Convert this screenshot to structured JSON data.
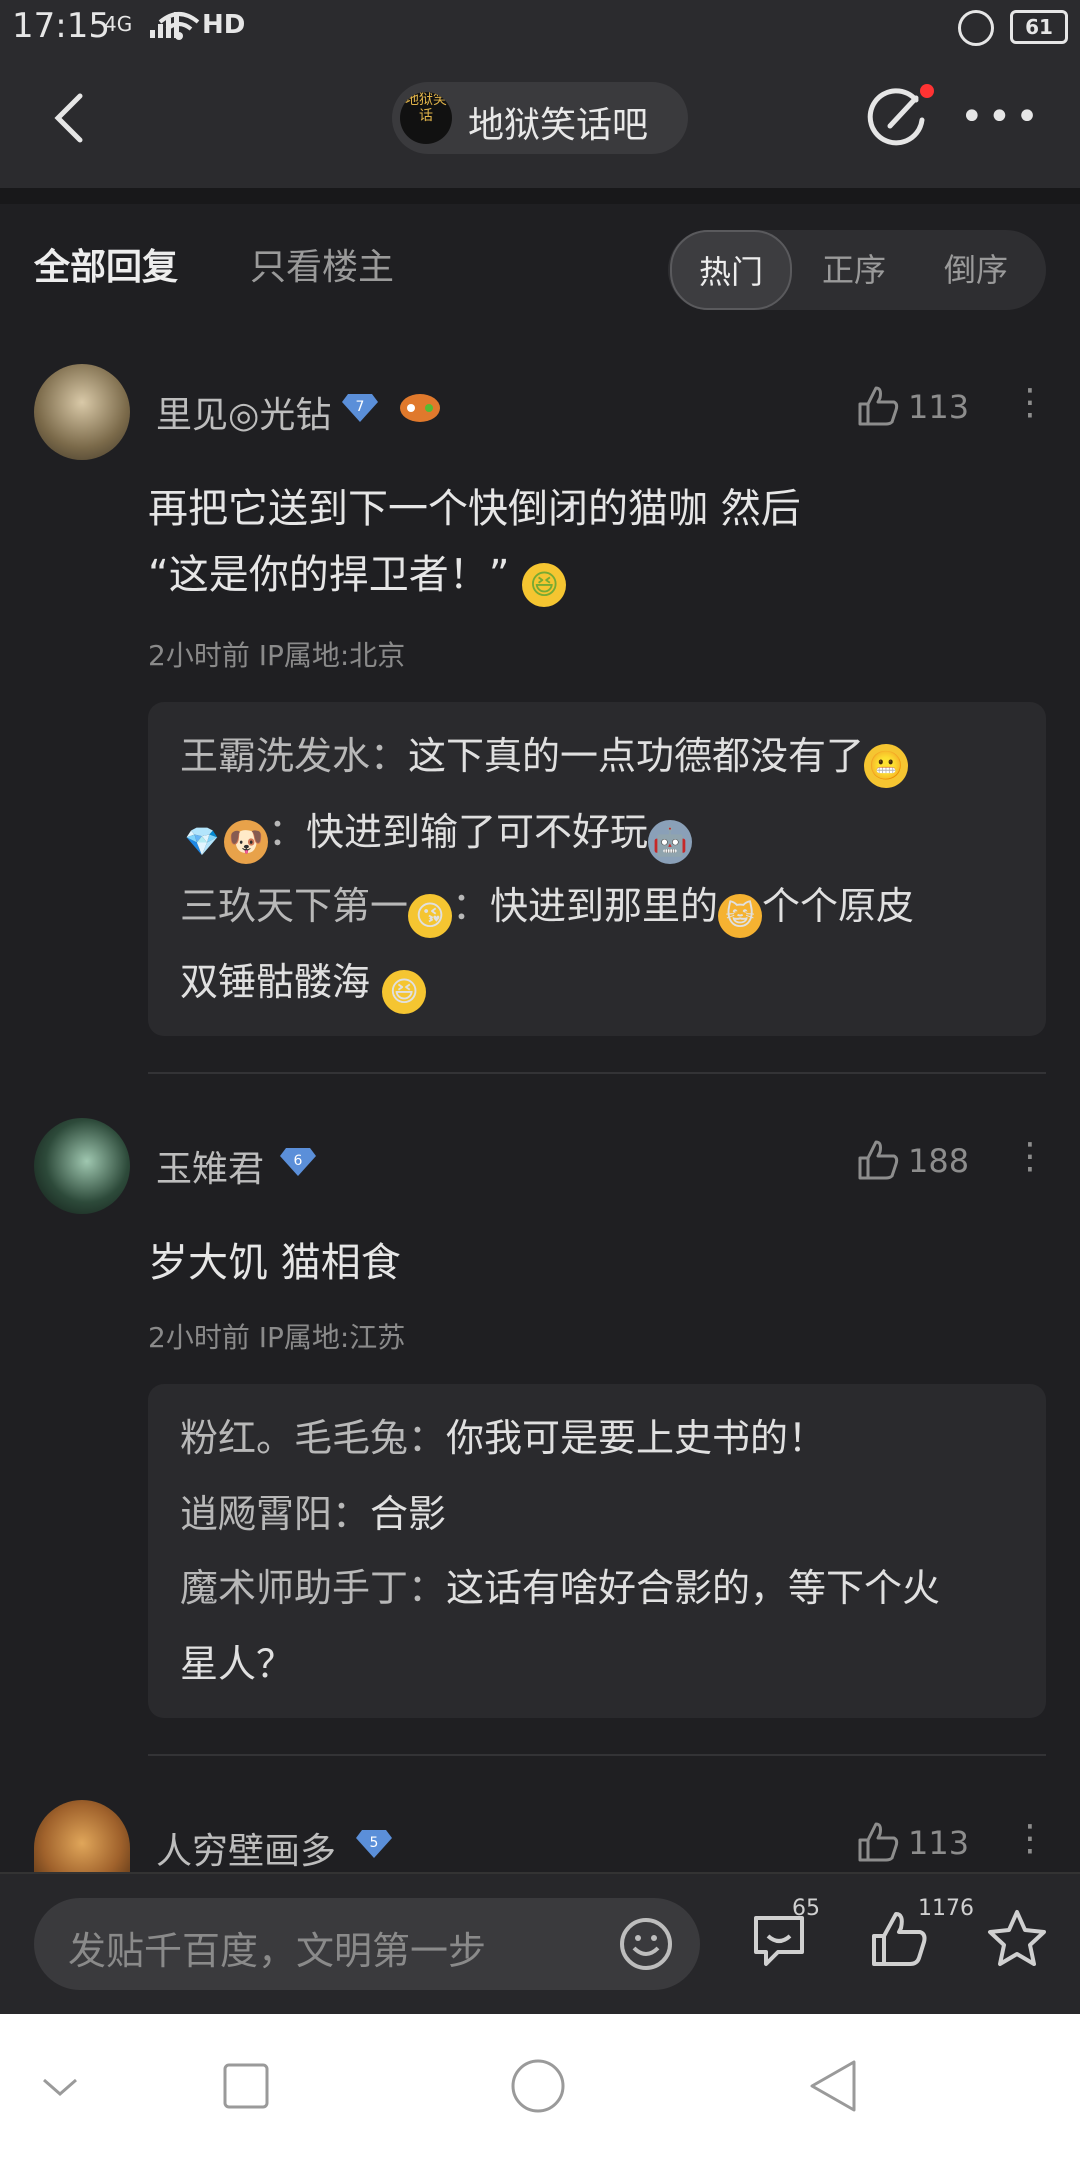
{
  "status_bar": {
    "time": "17:15",
    "signal": "4G",
    "network": "HD",
    "battery": "61"
  },
  "header": {
    "forum_title": "地狱笑话吧",
    "forum_avatar_text": "地狱笑话"
  },
  "tabs": {
    "all_replies": "全部回复",
    "only_op": "只看楼主"
  },
  "sort": {
    "hot": "热门",
    "ascending": "正序",
    "descending": "倒序"
  },
  "comments": [
    {
      "username": "里见◎光钻",
      "level": "7",
      "likes": "113",
      "body_line1": "再把它送到下一个快倒闭的猫咖 然后",
      "body_line2": "“这是你的捍卫者！”",
      "meta": "2小时前  IP属地:北京",
      "replies": [
        {
          "who": "王霸洗发水：",
          "text": "这下真的一点功德都没有了"
        },
        {
          "who": "：",
          "text": "快进到输了可不好玩"
        },
        {
          "who": "三玖天下第一",
          "sep": "：",
          "text": "快进到那里的",
          "text2": "个个原皮",
          "text3": "双锤骷髅海"
        }
      ]
    },
    {
      "username": "玉雉君",
      "level": "6",
      "likes": "188",
      "body_line1": "岁大饥 猫相食",
      "meta": "2小时前  IP属地:江苏",
      "replies": [
        {
          "who": "粉红。毛毛兔：",
          "text": "你我可是要上史书的！"
        },
        {
          "who": "逍飏霄阳：",
          "text": "合影"
        },
        {
          "who": "魔术师助手丁：",
          "text": "这话有啥好合影的，等下个火",
          "text2": "星人？"
        }
      ]
    },
    {
      "username": "人穷壁画多",
      "level": "5",
      "likes": "113"
    }
  ],
  "bottom_bar": {
    "placeholder": "发贴千百度，文明第一步",
    "comment_count": "65",
    "like_count": "1176"
  },
  "colors": {
    "background": "#1f1f22",
    "accent_diamond": "#5b8fd9",
    "notification_dot": "#ff3333"
  }
}
